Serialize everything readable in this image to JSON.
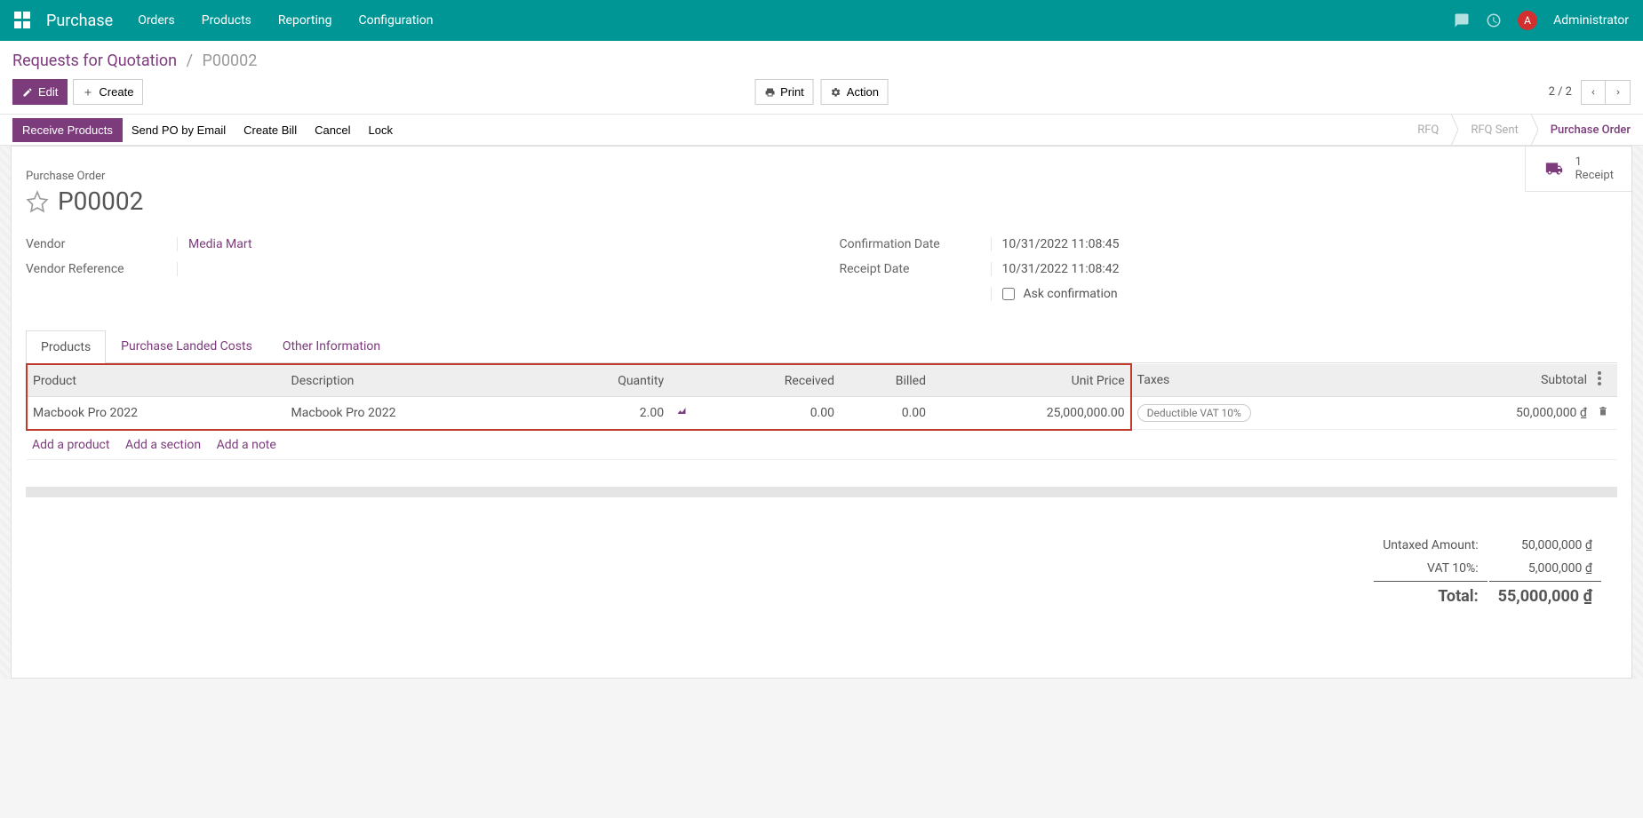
{
  "nav": {
    "brand": "Purchase",
    "links": [
      "Orders",
      "Products",
      "Reporting",
      "Configuration"
    ],
    "user_initial": "A",
    "user_name": "Administrator"
  },
  "breadcrumb": {
    "parent": "Requests for Quotation",
    "current": "P00002"
  },
  "toolbar": {
    "edit": "Edit",
    "create": "Create",
    "print": "Print",
    "action": "Action",
    "pager": "2 / 2"
  },
  "statusbar": {
    "receive": "Receive Products",
    "send": "Send PO by Email",
    "create_bill": "Create Bill",
    "cancel": "Cancel",
    "lock": "Lock",
    "steps": [
      "RFQ",
      "RFQ Sent",
      "Purchase Order"
    ]
  },
  "buttonbox": {
    "count": "1",
    "label": "Receipt"
  },
  "record": {
    "type_label": "Purchase Order",
    "name": "P00002",
    "vendor_label": "Vendor",
    "vendor": "Media Mart",
    "vendor_ref_label": "Vendor Reference",
    "vendor_ref": "",
    "confirm_date_label": "Confirmation Date",
    "confirm_date": "10/31/2022 11:08:45",
    "receipt_date_label": "Receipt Date",
    "receipt_date": "10/31/2022 11:08:42",
    "ask_confirmation": "Ask confirmation"
  },
  "tabs": [
    "Products",
    "Purchase Landed Costs",
    "Other Information"
  ],
  "table": {
    "headers": {
      "product": "Product",
      "description": "Description",
      "quantity": "Quantity",
      "received": "Received",
      "billed": "Billed",
      "unit_price": "Unit Price",
      "taxes": "Taxes",
      "subtotal": "Subtotal"
    },
    "row": {
      "product": "Macbook Pro 2022",
      "description": "Macbook Pro 2022",
      "quantity": "2.00",
      "received": "0.00",
      "billed": "0.00",
      "unit_price": "25,000,000.00",
      "taxes": "Deductible VAT 10%",
      "subtotal": "50,000,000 ₫"
    },
    "add_product": "Add a product",
    "add_section": "Add a section",
    "add_note": "Add a note"
  },
  "totals": {
    "untaxed_label": "Untaxed Amount:",
    "untaxed": "50,000,000 ₫",
    "vat_label": "VAT 10%:",
    "vat": "5,000,000 ₫",
    "total_label": "Total:",
    "total": "55,000,000 ₫"
  }
}
